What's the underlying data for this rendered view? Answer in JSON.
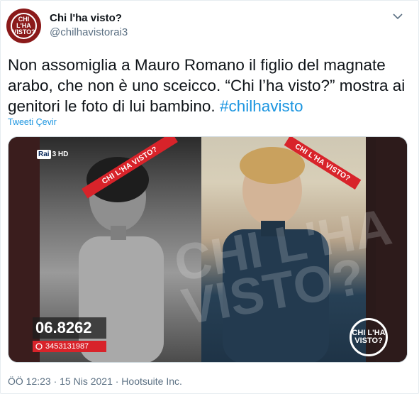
{
  "account": {
    "name": "Chi l'ha visto?",
    "handle": "@chilhavistorai3",
    "avatar_text": "CHI L'HA VISTO?"
  },
  "tweet": {
    "text": "Non assomiglia a Mauro Romano il figlio del magnate arabo, che non è uno sceicco. “Chi l’ha visto?” mostra ai genitori le foto di lui bambino. ",
    "hashtag": "#chilhavisto",
    "translate_label": "Tweeti Çevir",
    "timestamp": "ÖÖ 12:23 · 15 Nis 2021 · Hootsuite Inc."
  },
  "media": {
    "ribbon_left": "CHI L'HA VISTO?",
    "ribbon_right": "CHI L'HA VISTO?",
    "channel_logo": "Rai",
    "channel_suffix": "3 HD",
    "watermark": "CHI L'HA VISTO?",
    "phone_number": "06.8262",
    "whatsapp_number": "3453131987",
    "corner_logo_text": "CHI L'HA VISTO?"
  },
  "icons": {
    "more": "chevron-down-icon",
    "whatsapp": "whatsapp-icon"
  },
  "colors": {
    "hashtag": "#1b95e0",
    "secondary": "#5b7083",
    "ribbon": "#d8232a",
    "avatar": "#8b1a1a"
  }
}
